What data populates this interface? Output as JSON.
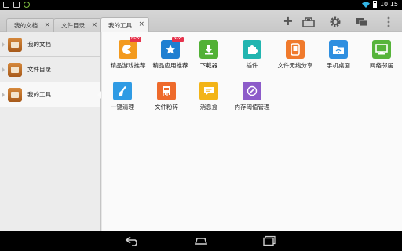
{
  "status": {
    "time": "10:15"
  },
  "tabs": [
    {
      "label": "我的文档",
      "close": "×"
    },
    {
      "label": "文件目录",
      "close": "×"
    },
    {
      "label": "我的工具",
      "close": "×"
    }
  ],
  "toolbar": {
    "add": "+"
  },
  "sidebar": {
    "items": [
      {
        "label": "我的文档"
      },
      {
        "label": "文件目录"
      },
      {
        "label": "我的工具"
      }
    ]
  },
  "tools": [
    {
      "label": "精品游戏推荐",
      "badge": "NEW",
      "color": "#f39a1e",
      "icon": "game-icon"
    },
    {
      "label": "精品应用推荐",
      "badge": "NEW",
      "color": "#1f7fd1",
      "icon": "app-store-icon"
    },
    {
      "label": "下載器",
      "color": "#52b136",
      "icon": "download-icon"
    },
    {
      "label": "插件",
      "color": "#22b5b0",
      "icon": "puzzle-icon"
    },
    {
      "label": "文件无线分享",
      "color": "#f07a2c",
      "icon": "wireless-share-icon"
    },
    {
      "label": "手机桌面",
      "color": "#2f8fe0",
      "icon": "wifi-folder-icon"
    },
    {
      "label": "网络邻居",
      "color": "#56b43a",
      "icon": "network-monitor-icon"
    },
    {
      "label": "一键清理",
      "color": "#2f9be4",
      "icon": "broom-icon"
    },
    {
      "label": "文件粉碎",
      "color": "#ee6a2b",
      "icon": "shredder-icon"
    },
    {
      "label": "消息盒",
      "color": "#f3b417",
      "icon": "message-box-icon"
    },
    {
      "label": "内存阈值管理",
      "color": "#8c5bc9",
      "icon": "memory-icon"
    }
  ]
}
